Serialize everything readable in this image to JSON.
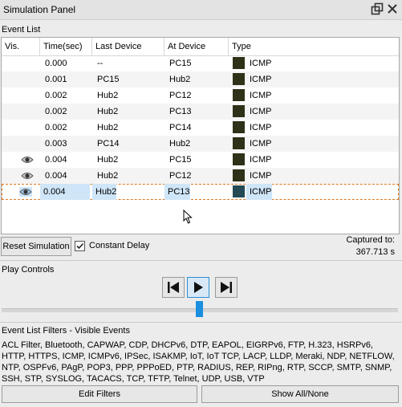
{
  "window": {
    "title": "Simulation Panel"
  },
  "event_list": {
    "label": "Event List",
    "columns": [
      "Vis.",
      "Time(sec)",
      "Last Device",
      "At Device",
      "Type"
    ],
    "rows": [
      {
        "vis": false,
        "time": "0.000",
        "last": "--",
        "at": "PC15",
        "type": "ICMP"
      },
      {
        "vis": false,
        "time": "0.001",
        "last": "PC15",
        "at": "Hub2",
        "type": "ICMP"
      },
      {
        "vis": false,
        "time": "0.002",
        "last": "Hub2",
        "at": "PC12",
        "type": "ICMP"
      },
      {
        "vis": false,
        "time": "0.002",
        "last": "Hub2",
        "at": "PC13",
        "type": "ICMP"
      },
      {
        "vis": false,
        "time": "0.002",
        "last": "Hub2",
        "at": "PC14",
        "type": "ICMP"
      },
      {
        "vis": false,
        "time": "0.003",
        "last": "PC14",
        "at": "Hub2",
        "type": "ICMP"
      },
      {
        "vis": true,
        "time": "0.004",
        "last": "Hub2",
        "at": "PC15",
        "type": "ICMP"
      },
      {
        "vis": true,
        "time": "0.004",
        "last": "Hub2",
        "at": "PC12",
        "type": "ICMP"
      },
      {
        "vis": true,
        "time": "0.004",
        "last": "Hub2",
        "at": "PC13",
        "type": "ICMP",
        "selected": true
      }
    ]
  },
  "controls": {
    "reset_label": "Reset Simulation",
    "constant_delay_label": "Constant Delay",
    "constant_delay_checked": true,
    "captured_label": "Captured to:",
    "captured_value": "367.713 s"
  },
  "play_controls": {
    "label": "Play Controls"
  },
  "filters": {
    "label": "Event List Filters - Visible Events",
    "text": "ACL Filter, Bluetooth, CAPWAP, CDP, DHCPv6, DTP, EAPOL, EIGRPv6, FTP, H.323, HSRPv6, HTTP, HTTPS, ICMP, ICMPv6, IPSec, ISAKMP, IoT, IoT TCP, LACP, LLDP, Meraki, NDP, NETFLOW, NTP, OSPFv6, PAgP, POP3, PPP, PPPoED, PTP, RADIUS, REP, RIPng, RTP, SCCP, SMTP, SNMP, SSH, STP, SYSLOG, TACACS, TCP, TFTP, Telnet, UDP, USB, VTP",
    "edit_label": "Edit Filters",
    "show_label": "Show All/None"
  },
  "colors": {
    "type_swatch": "#2f3118",
    "type_swatch_selected": "#234a55",
    "accent": "#1b8fe0"
  }
}
